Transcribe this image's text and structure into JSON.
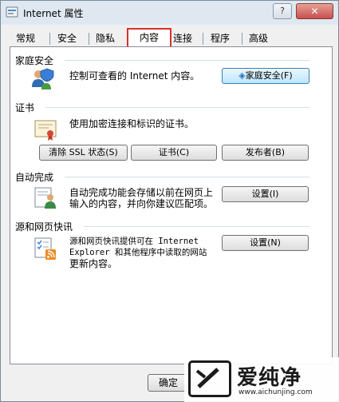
{
  "window": {
    "title": "Internet 属性",
    "help_label": "?",
    "close_label": "✕"
  },
  "tabs": [
    "常规",
    "安全",
    "隐私",
    "内容",
    "连接",
    "程序",
    "高级"
  ],
  "active_tab": "内容",
  "groups": {
    "family_safety": {
      "title": "家庭安全",
      "description": "控制可查看的 Internet 内容。",
      "button_label": "家庭安全(F)",
      "icon": "family-safety-icon"
    },
    "certificates": {
      "title": "证书",
      "description": "使用加密连接和标识的证书。",
      "buttons": [
        "清除 SSL 状态(S)",
        "证书(C)",
        "发布者(B)"
      ],
      "icon": "certificate-icon"
    },
    "autocomplete": {
      "title": "自动完成",
      "description_lines": [
        "自动完成功能会存储以前在网页上",
        "输入的内容，并向你建议匹配项。"
      ],
      "button_label": "设置(I)",
      "icon": "autocomplete-icon"
    },
    "feeds": {
      "title": "源和网页快讯",
      "description_lines": [
        "源和网页快讯提供可在 Internet",
        "Explorer 和其他程序中读取的网站",
        "更新内容。"
      ],
      "button_label": "设置(N)",
      "icon": "rss-feed-icon"
    }
  },
  "footer": {
    "ok_label": "确定"
  },
  "watermark": {
    "text": "爱纯净",
    "url": "www.aichunjing.com"
  },
  "colors": {
    "active_tab_highlight": "#d9302c",
    "titlebar": "#dfe8f1",
    "close_button": "#c75050"
  }
}
